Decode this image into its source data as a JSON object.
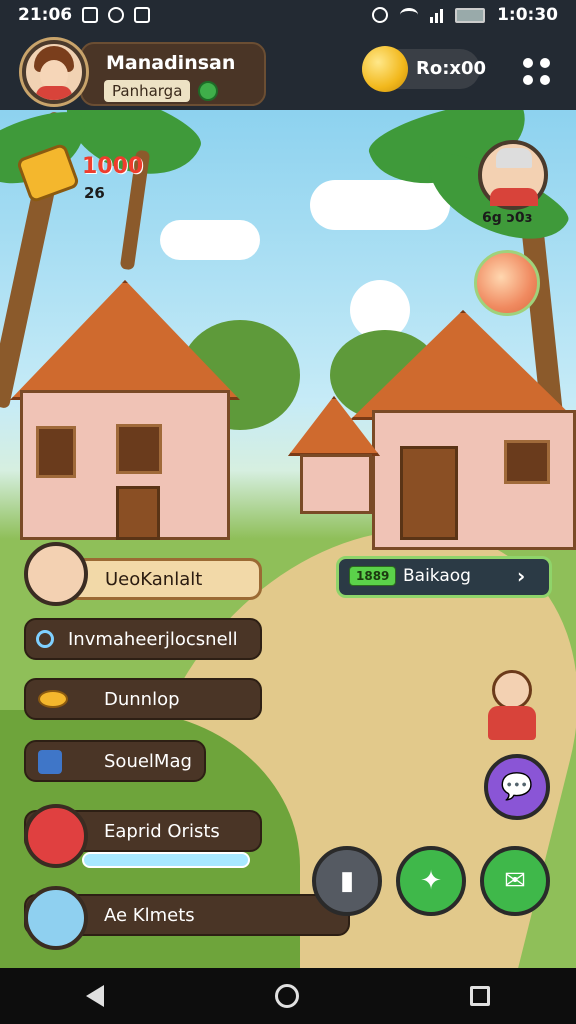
{
  "status_bar": {
    "time": "21:06",
    "clock_right": "1:0:30"
  },
  "profile": {
    "name": "Manadinsan",
    "subtitle": "Panharga"
  },
  "currency": {
    "label": "Ro:x00"
  },
  "resource": {
    "amount": "1000",
    "sub": "26"
  },
  "npc_top": {
    "label": "6g ɔ0ɜ"
  },
  "quest": {
    "tag": "1889",
    "label": "Baikaog",
    "arrow": "›"
  },
  "side_menu": [
    {
      "label": "UeoKanlalt"
    },
    {
      "label": "Invmaheerjlocsnell"
    },
    {
      "label": "Dunnlop"
    },
    {
      "label": "SouelMag"
    },
    {
      "label": "Eaprid Orists"
    },
    {
      "label": "Ae Klmets"
    }
  ],
  "colors": {
    "accent_green": "#5bd14a",
    "plate_brown": "#4a3526",
    "chat_purple": "#8a55d6"
  },
  "icons": [
    "menu-dots-icon",
    "coin-icon",
    "gem-icon",
    "chat-icon",
    "map-icon",
    "message-icon",
    "back-icon",
    "home-icon",
    "recent-apps-icon"
  ]
}
